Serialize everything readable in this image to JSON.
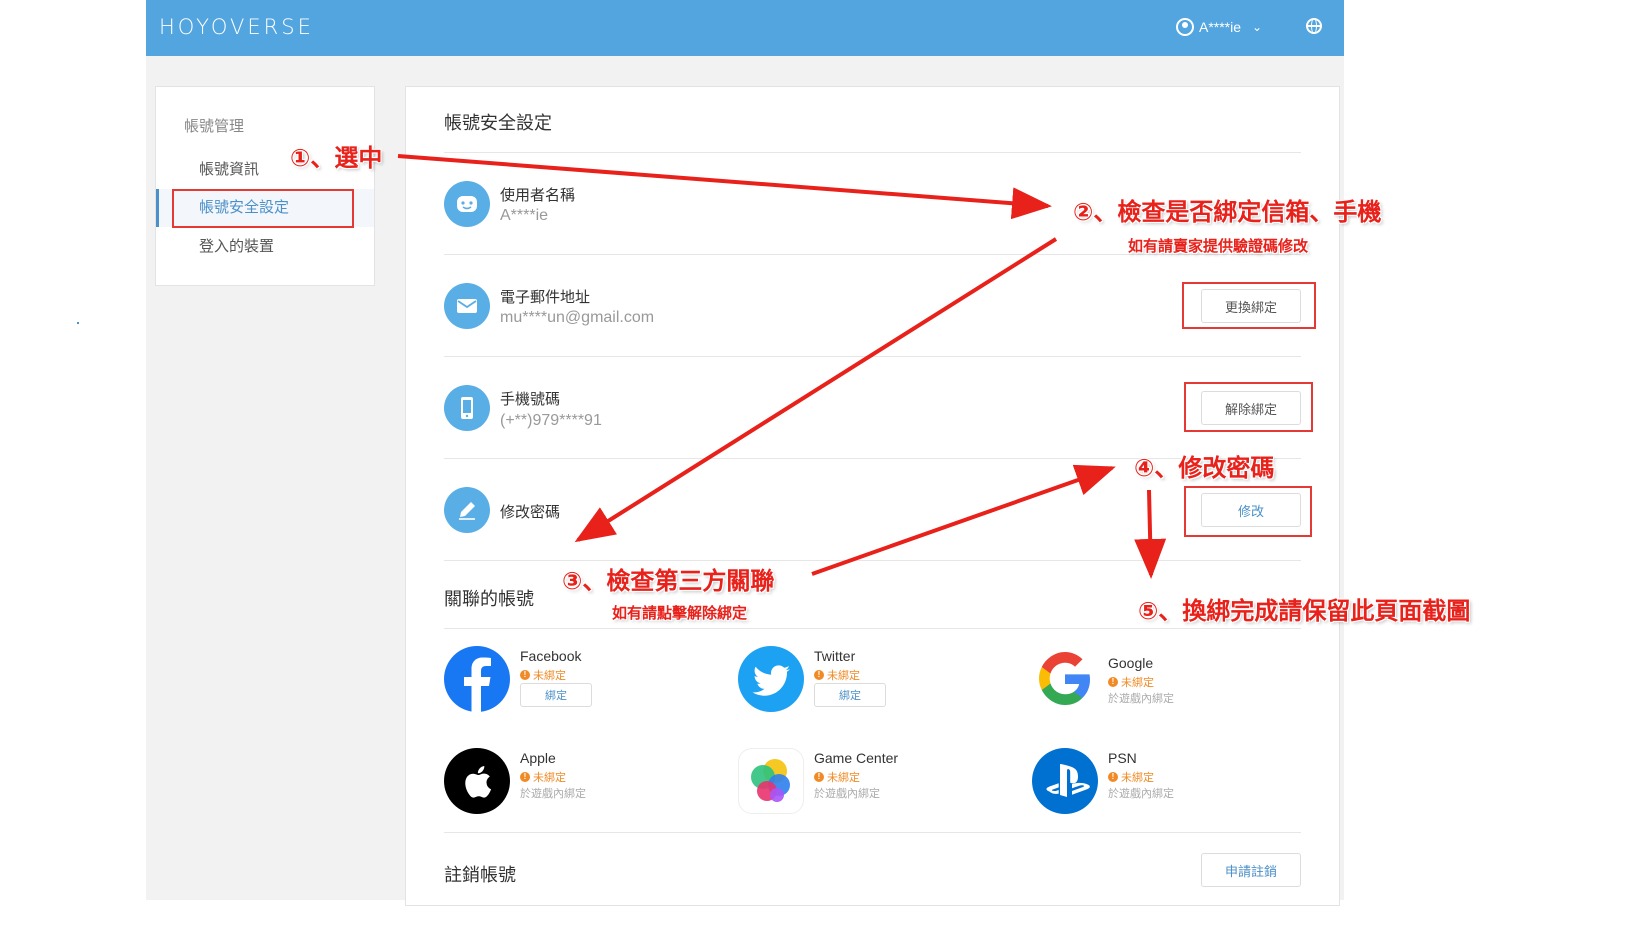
{
  "header": {
    "logo": "HOYOVERSE",
    "username": "A****ie"
  },
  "sidebar": {
    "heading": "帳號管理",
    "items": [
      {
        "label": "帳號資訊"
      },
      {
        "label": "帳號安全設定"
      },
      {
        "label": "登入的裝置"
      }
    ]
  },
  "main": {
    "title": "帳號安全設定",
    "rows": {
      "username": {
        "label": "使用者名稱",
        "value": "A****ie"
      },
      "email": {
        "label": "電子郵件地址",
        "value": "mu****un@gmail.com",
        "button": "更換綁定"
      },
      "phone": {
        "label": "手機號碼",
        "value": "(+**)979****91",
        "button": "解除綁定"
      },
      "password": {
        "label": "修改密碼",
        "button": "修改"
      }
    },
    "linked_title": "關聯的帳號",
    "linked": [
      {
        "name": "Facebook",
        "status": "未綁定",
        "action": "綁定"
      },
      {
        "name": "Twitter",
        "status": "未綁定",
        "action": "綁定"
      },
      {
        "name": "Google",
        "status": "未綁定",
        "note": "於遊戲內綁定"
      },
      {
        "name": "Apple",
        "status": "未綁定",
        "note": "於遊戲內綁定"
      },
      {
        "name": "Game Center",
        "status": "未綁定",
        "note": "於遊戲內綁定"
      },
      {
        "name": "PSN",
        "status": "未綁定",
        "note": "於遊戲內綁定"
      }
    ],
    "cancel_title": "註銷帳號",
    "cancel_button": "申請註銷"
  },
  "annotations": {
    "step1": "①、選中",
    "step2": "②、檢查是否綁定信箱、手機",
    "step2_sub": "如有請賣家提供驗證碼修改",
    "step3": "③、檢查第三方關聯",
    "step3_sub": "如有請點擊解除綁定",
    "step4": "④、修改密碼",
    "step5": "⑤、換綁完成請保留此頁面截圖"
  },
  "colors": {
    "topbar": "#53a5e0",
    "accent": "#4a90c9",
    "annotation": "#e8211b",
    "warning": "#f08a24"
  }
}
